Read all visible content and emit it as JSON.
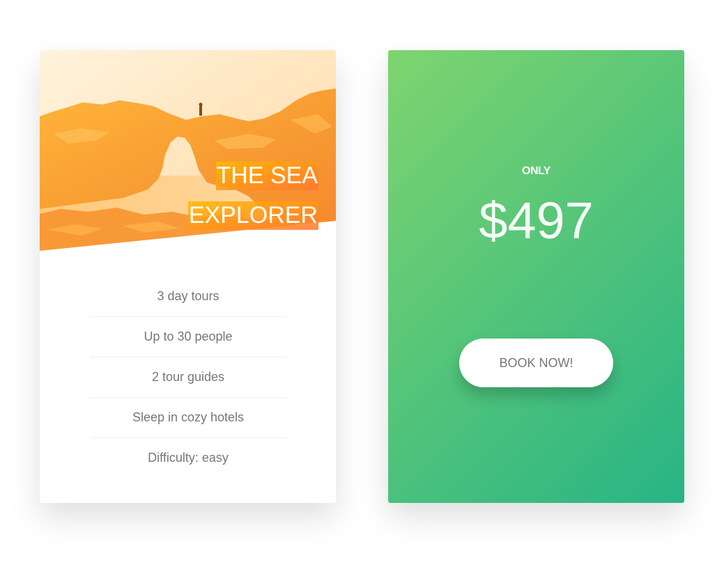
{
  "card_front": {
    "heading_line_1": "THE SEA",
    "heading_line_2": "EXPLORER",
    "features": [
      "3 day tours",
      "Up to 30 people",
      "2 tour guides",
      "Sleep in cozy hotels",
      "Difficulty: easy"
    ]
  },
  "card_back": {
    "price_only_label": "ONLY",
    "price_value": "$497",
    "book_button_label": "BOOK NOW!"
  },
  "colors": {
    "orange_light": "#ffb900",
    "orange_dark": "#ff7730",
    "green_light": "#7ed56f",
    "green_dark": "#28b485",
    "feature_text": "#777777"
  }
}
